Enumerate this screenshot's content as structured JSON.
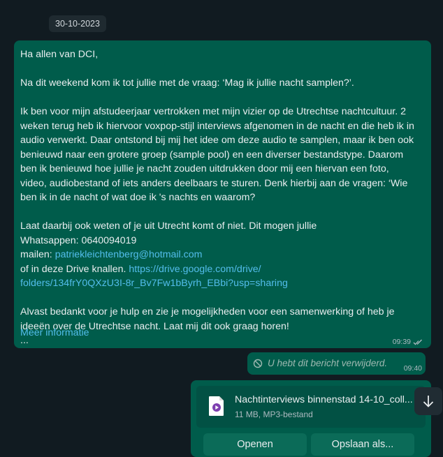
{
  "date_chip": "30-10-2023",
  "message1": {
    "greeting": "Ha allen van DCI,",
    "intro": "Na dit weekend kom ik tot jullie met de vraag: ‘Mag ik jullie nacht samplen?’.",
    "body_line1": "Ik ben voor mijn afstudeerjaar vertrokken met mijn vizier op de Utrechtse nachtcultuur. 2",
    "body_line2": "weken terug heb ik hiervoor voxpop-stijl interviews afgenomen in de nacht en die heb ik in",
    "body_line3": "audio verwerkt. Daar ontstond bij mij het idee om deze audio te samplen, maar ik ben ook",
    "body_line4": "benieuwd naar een grotere groep (sample pool) en een diverser bestandstype. Daarom",
    "body_line5": "ben ik benieuwd hoe jullie je nacht zouden uitdrukken door mij een hiervan een foto,",
    "body_line6": "video, audiobestand of iets anders deelbaars te sturen. Denk hierbij aan de vragen: ‘Wie",
    "body_line7": "ben ik in de nacht of wat doe ik 's nachts en waarom?",
    "contact_line1": "Laat daarbij ook weten of je uit Utrecht komt of niet. Dit mogen jullie",
    "contact_line2": "Whatsappen: 0640094019",
    "mail_label": "mailen: ",
    "mail_link": "patriekleichtenberg@hotmail.com",
    "drive_label": "of in deze Drive knallen. ",
    "drive_link1": "https://drive.google.com/drive/",
    "drive_link2": "folders/134frY0QXzU3I-8r_Bv7Fw1bByrh_EBbi?usp=sharing",
    "closing_line1": "Alvast bedankt voor je hulp en zie je mogelijkheden voor een samenwerking of heb je",
    "closing_line2": "ideeën over de Utrechtse nacht. Laat mij dit ook graag horen!",
    "ellipsis": "...",
    "more_link": "Meer informatie",
    "time": "09:39"
  },
  "message2": {
    "text": "U hebt dit bericht verwijderd.",
    "time": "09:40"
  },
  "message3": {
    "file_name": "Nachtinterviews binnenstad 14-10_coll...",
    "file_meta": "11 MB, MP3-bestand",
    "open_label": "Openen",
    "save_label": "Opslaan als..."
  },
  "colors": {
    "background": "#111b21",
    "outgoing_bubble": "#005c4b",
    "link": "#53bdeb"
  },
  "icons": {
    "read_receipt": "double-check-icon",
    "deleted": "blocked-icon",
    "file": "audio-file-icon",
    "download": "arrow-down-icon"
  }
}
